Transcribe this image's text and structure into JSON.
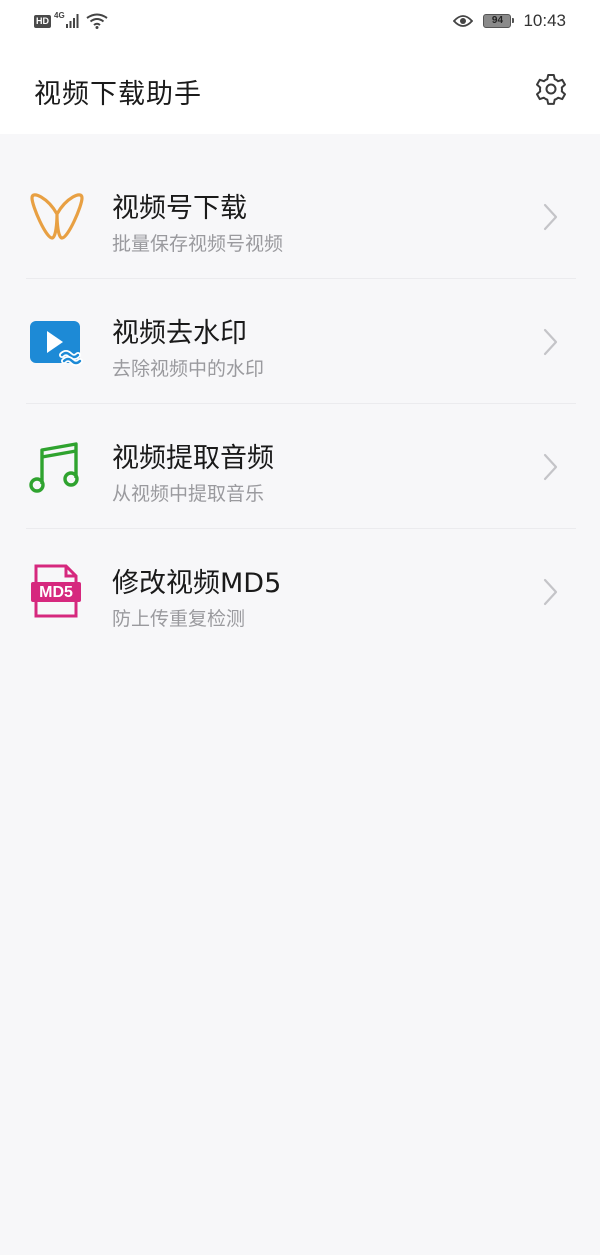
{
  "status_bar": {
    "hd": "HD",
    "network": "4G",
    "battery": "94",
    "time": "10:43",
    "icons": [
      "signal-icon",
      "wifi-icon",
      "eye-icon",
      "battery-icon"
    ]
  },
  "header": {
    "title": "视频下载助手",
    "settings_icon": "gear-icon"
  },
  "tools": [
    {
      "title": "视频号下载",
      "subtitle": "批量保存视频号视频",
      "icon": "channels-logo-icon",
      "color": "#e8a043"
    },
    {
      "title": "视频去水印",
      "subtitle": "去除视频中的水印",
      "icon": "play-wave-icon",
      "color": "#1d8ad6"
    },
    {
      "title": "视频提取音频",
      "subtitle": "从视频中提取音乐",
      "icon": "music-note-icon",
      "color": "#2fa32f"
    },
    {
      "title": "修改视频MD5",
      "subtitle": "防上传重复检测",
      "icon": "md5-file-icon",
      "color": "#d6287e"
    }
  ],
  "md5_icon_label": "MD5",
  "colors": {
    "background": "#f7f7f9",
    "header": "#ffffff",
    "subtitle": "#9a9a9e",
    "chevron": "#c4c4c8"
  }
}
